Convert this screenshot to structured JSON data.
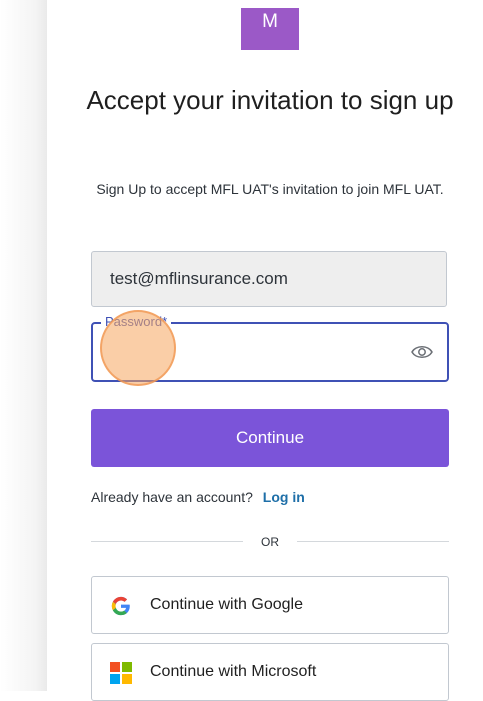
{
  "logo": {
    "letter": "M"
  },
  "heading": {
    "title": "Accept your invitation to sign up"
  },
  "subtitle": "Sign Up to accept MFL UAT's invitation to join MFL UAT.",
  "form": {
    "email_value": "test@mflinsurance.com",
    "password_label": "Password*",
    "password_value": "",
    "continue_label": "Continue"
  },
  "login": {
    "prompt": "Already have an account?",
    "link_label": "Log in"
  },
  "divider": {
    "label": "OR"
  },
  "social": {
    "google_label": "Continue with Google",
    "microsoft_label": "Continue with Microsoft"
  },
  "colors": {
    "primary": "#7b54d9",
    "focus": "#3f51b5",
    "link": "#1e6fa8",
    "logo_bg": "#9b59c7"
  }
}
